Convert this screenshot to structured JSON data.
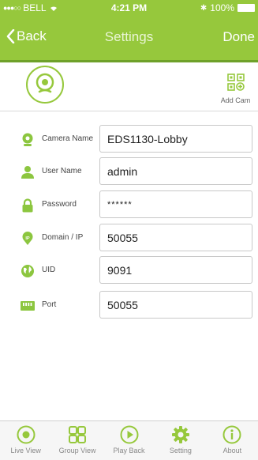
{
  "status_bar": {
    "signal": "●●●○○",
    "carrier": "BELL",
    "wifi_icon": "wifi-icon",
    "time": "4:21 PM",
    "bluetooth": "✱",
    "battery": "100%"
  },
  "nav": {
    "back_label": "Back",
    "title": "Settings",
    "done_label": "Done"
  },
  "header": {
    "add_cam_label": "Add Cam"
  },
  "fields": [
    {
      "label": "Camera Name",
      "value": "EDS1130-Lobby",
      "icon": "location-pin-icon"
    },
    {
      "label": "User Name",
      "value": "admin",
      "icon": "user-icon"
    },
    {
      "label": "Password",
      "value": "******",
      "icon": "lock-icon"
    },
    {
      "label": "Domain / IP",
      "value": "50055",
      "icon": "ip-pin-icon"
    },
    {
      "label": "UID",
      "value": "9091",
      "icon": "globe-icon"
    },
    {
      "label": "Port",
      "value": "50055",
      "icon": "ethernet-port-icon"
    }
  ],
  "tabs": [
    {
      "label": "Live View",
      "icon": "live-view-icon"
    },
    {
      "label": "Group View",
      "icon": "grid-icon"
    },
    {
      "label": "Play Back",
      "icon": "play-icon"
    },
    {
      "label": "Setting",
      "icon": "gear-icon"
    },
    {
      "label": "About",
      "icon": "info-icon"
    }
  ],
  "colors": {
    "accent": "#96c83c",
    "accent_dark": "#6ea12a",
    "icon_green": "#8cc63f"
  }
}
